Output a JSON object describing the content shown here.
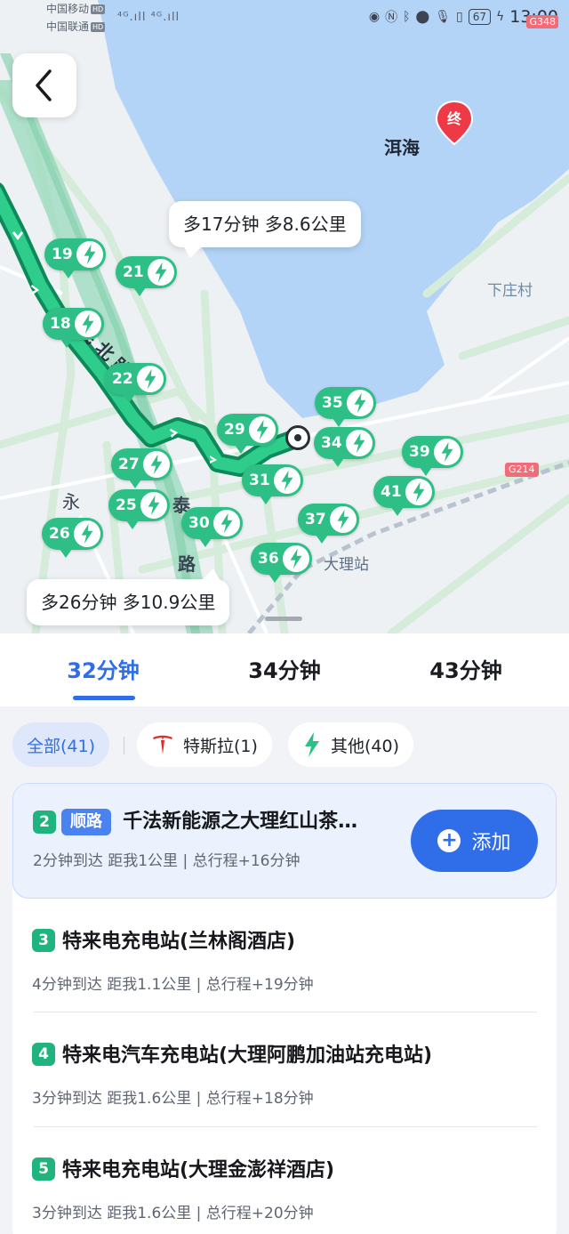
{
  "status_bar": {
    "carrier1": "中国移动",
    "carrier2": "中国联通",
    "hd": "HD",
    "signals": "⁴ᴳ.ıll ⁴ᴳ.ıll",
    "battery": "67",
    "time": "13:00",
    "road_badge": "G348"
  },
  "map": {
    "lake_label": "洱海",
    "end_pin_label": "终",
    "village_label": "下庄村",
    "road_renmin_north": "人民北路",
    "road_tai": "泰",
    "road_lu": "路",
    "road_yong": "永",
    "station_label": "大理站",
    "highway_label": "G214",
    "callout_top": "多17分钟 多8.6公里",
    "callout_bottom": "多26分钟 多10.9公里",
    "markers": [
      "19",
      "21",
      "18",
      "22",
      "27",
      "25",
      "26",
      "29",
      "30",
      "31",
      "35",
      "34",
      "39",
      "41",
      "37",
      "36"
    ]
  },
  "tabs": [
    {
      "label": "32分钟",
      "active": true
    },
    {
      "label": "34分钟",
      "active": false
    },
    {
      "label": "43分钟",
      "active": false
    }
  ],
  "filters": [
    {
      "label": "全部(41)",
      "active": true
    },
    {
      "label": "特斯拉(1)",
      "active": false
    },
    {
      "label": "其他(40)",
      "active": false
    }
  ],
  "stations": [
    {
      "rank": "2",
      "tag": "顺路",
      "name": "千法新能源之大理红山茶…",
      "meta": "2分钟到达  距我1公里 | 总行程+16分钟",
      "button": "添加"
    },
    {
      "rank": "3",
      "name": "特来电充电站(兰林阁酒店)",
      "meta": "4分钟到达  距我1.1公里 | 总行程+19分钟"
    },
    {
      "rank": "4",
      "name": "特来电汽车充电站(大理阿鹏加油站充电站)",
      "meta": "3分钟到达  距我1.6公里 | 总行程+18分钟"
    },
    {
      "rank": "5",
      "name": "特来电充电站(大理金澎祥酒店)",
      "meta": "3分钟到达  距我1.6公里 | 总行程+20分钟"
    }
  ],
  "colors": {
    "accent": "#2f6ee8",
    "charger": "#2dbf86",
    "route": "#1fb47d",
    "lake": "#b3d4f7",
    "tesla": "#e22b2b"
  }
}
